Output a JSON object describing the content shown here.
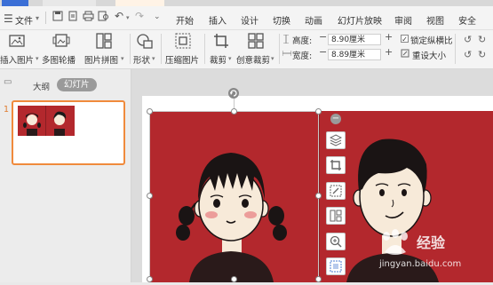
{
  "menubar": {
    "file_label": "文件",
    "items": [
      "开始",
      "插入",
      "设计",
      "切换",
      "动画",
      "幻灯片放映",
      "审阅",
      "视图",
      "安全"
    ]
  },
  "ribbon": {
    "insert_picture": "插入图片",
    "multi_carousel": "多图轮播",
    "picture_collage": "图片拼图",
    "shape": "形状",
    "compress_picture": "压缩图片",
    "crop": "裁剪",
    "creative_crop": "创意裁剪",
    "height_label": "高度:",
    "height_value": "8.90厘米",
    "width_label": "宽度:",
    "width_value": "8.89厘米",
    "lock_ratio_label": "锁定纵横比",
    "lock_ratio_checked": true,
    "reset_size_label": "重设大小"
  },
  "panel": {
    "tab_outline": "大纲",
    "tab_slides": "幻灯片",
    "slide_number": "1"
  },
  "watermark": {
    "brand": "经验",
    "url": "jingyan.baidu.com"
  },
  "colors": {
    "accent": "#f08a3c",
    "slide_red": "#b3282d"
  }
}
